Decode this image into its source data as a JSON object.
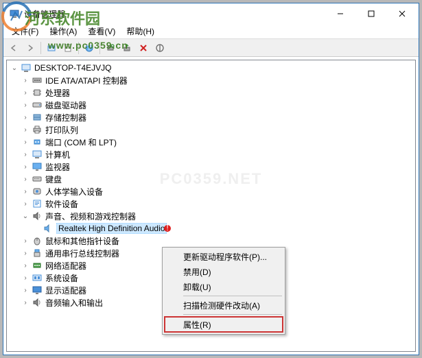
{
  "window": {
    "title": "设备管理器"
  },
  "menu": {
    "file": "文件(F)",
    "action": "操作(A)",
    "view": "查看(V)",
    "help": "帮助(H)"
  },
  "tree": {
    "root": "DESKTOP-T4EJVJQ",
    "items": [
      "IDE ATA/ATAPI 控制器",
      "处理器",
      "磁盘驱动器",
      "存储控制器",
      "打印队列",
      "端口 (COM 和 LPT)",
      "计算机",
      "监视器",
      "键盘",
      "人体学输入设备",
      "软件设备",
      "声音、视频和游戏控制器",
      "鼠标和其他指针设备",
      "通用串行总线控制器",
      "网络适配器",
      "系统设备",
      "显示适配器",
      "音频输入和输出"
    ],
    "selected_device": "Realtek High Definition Audio"
  },
  "context_menu": {
    "update_driver": "更新驱动程序软件(P)...",
    "disable": "禁用(D)",
    "uninstall": "卸载(U)",
    "scan": "扫描检测硬件改动(A)",
    "properties": "属性(R)"
  },
  "watermark": {
    "site_name": "河东软件园",
    "url": "www.pc0359.cn",
    "center": "PC0359.NET"
  },
  "colors": {
    "selection": "#cce8ff",
    "highlight_box": "#c33"
  }
}
